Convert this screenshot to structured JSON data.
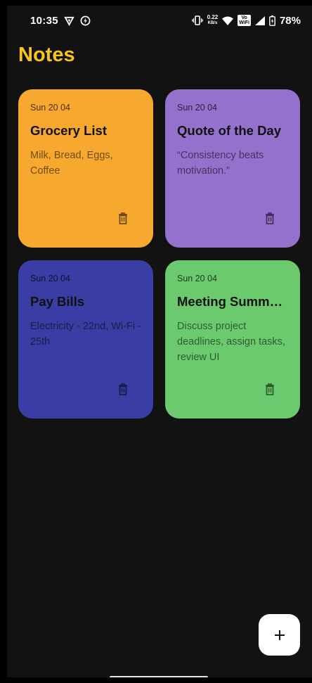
{
  "status_bar": {
    "time": "10:35",
    "net_speed_value": "0.22",
    "net_speed_unit": "KB/s",
    "volte_line1": "Vo",
    "volte_line2": "WiFi",
    "battery_percent": "78%"
  },
  "header": {
    "title": "Notes"
  },
  "notes": [
    {
      "date": "Sun 20 04",
      "title": "Grocery List",
      "body": "Milk, Bread, Eggs, Coffee",
      "color": "#f7a82f"
    },
    {
      "date": "Sun 20 04",
      "title": "Quote of the Day",
      "body": "“Consistency beats motivation.”",
      "color": "#9471cc"
    },
    {
      "date": "Sun 20 04",
      "title": "Pay Bills",
      "body": "Electricity - 22nd, Wi-Fi - 25th",
      "color": "#3a3ea4"
    },
    {
      "date": "Sun 20 04",
      "title": "Meeting Summa…",
      "body": "Discuss project deadlines, assign tasks, review UI",
      "color": "#6bca6e"
    }
  ],
  "fab": {
    "label": "+"
  },
  "colors": {
    "background": "#121212",
    "title_accent": "#f5c518",
    "fab_background": "#ffffff"
  },
  "icons": {
    "delete": "trash-icon",
    "add": "plus-icon"
  }
}
